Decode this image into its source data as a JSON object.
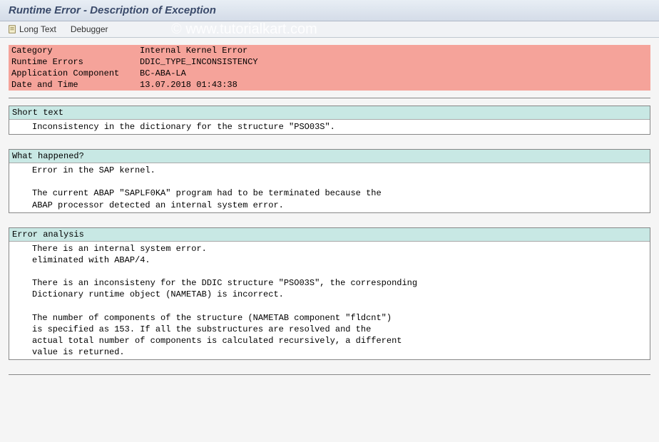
{
  "header": {
    "title": "Runtime Error - Description of Exception"
  },
  "toolbar": {
    "long_text": "Long Text",
    "debugger": "Debugger"
  },
  "info": {
    "category_label": "Category",
    "category_value": "Internal Kernel Error",
    "runtime_errors_label": "Runtime Errors",
    "runtime_errors_value": "DDIC_TYPE_INCONSISTENCY",
    "app_component_label": "Application Component",
    "app_component_value": "BC-ABA-LA",
    "datetime_label": "Date and Time",
    "datetime_value": "13.07.2018 01:43:38"
  },
  "sections": {
    "short_text": {
      "title": "Short text",
      "line1": "Inconsistency in the dictionary for the structure \"PSO03S\"."
    },
    "what_happened": {
      "title": "What happened?",
      "line1": "Error in the SAP kernel.",
      "line2": "",
      "line3": "The current ABAP \"SAPLF0KA\" program had to be terminated because the",
      "line4": "ABAP processor detected an internal system error."
    },
    "error_analysis": {
      "title": "Error analysis",
      "line1": "There is an internal system error.",
      "line2": "eliminated with ABAP/4.",
      "line3": "",
      "line4": "There is an inconsisteny for the DDIC structure \"PSO03S\", the corresponding",
      "line5": "Dictionary runtime object (NAMETAB) is incorrect.",
      "line6": "",
      "line7": "The number of components of the structure (NAMETAB component \"fldcnt\")",
      "line8": "is specified as 153. If all the substructures are resolved and the",
      "line9": "actual total number of components is calculated recursively, a different",
      "line10": "value is returned."
    }
  },
  "watermark": {
    "copy": "©",
    "text": "www.tutorialkart.com"
  }
}
